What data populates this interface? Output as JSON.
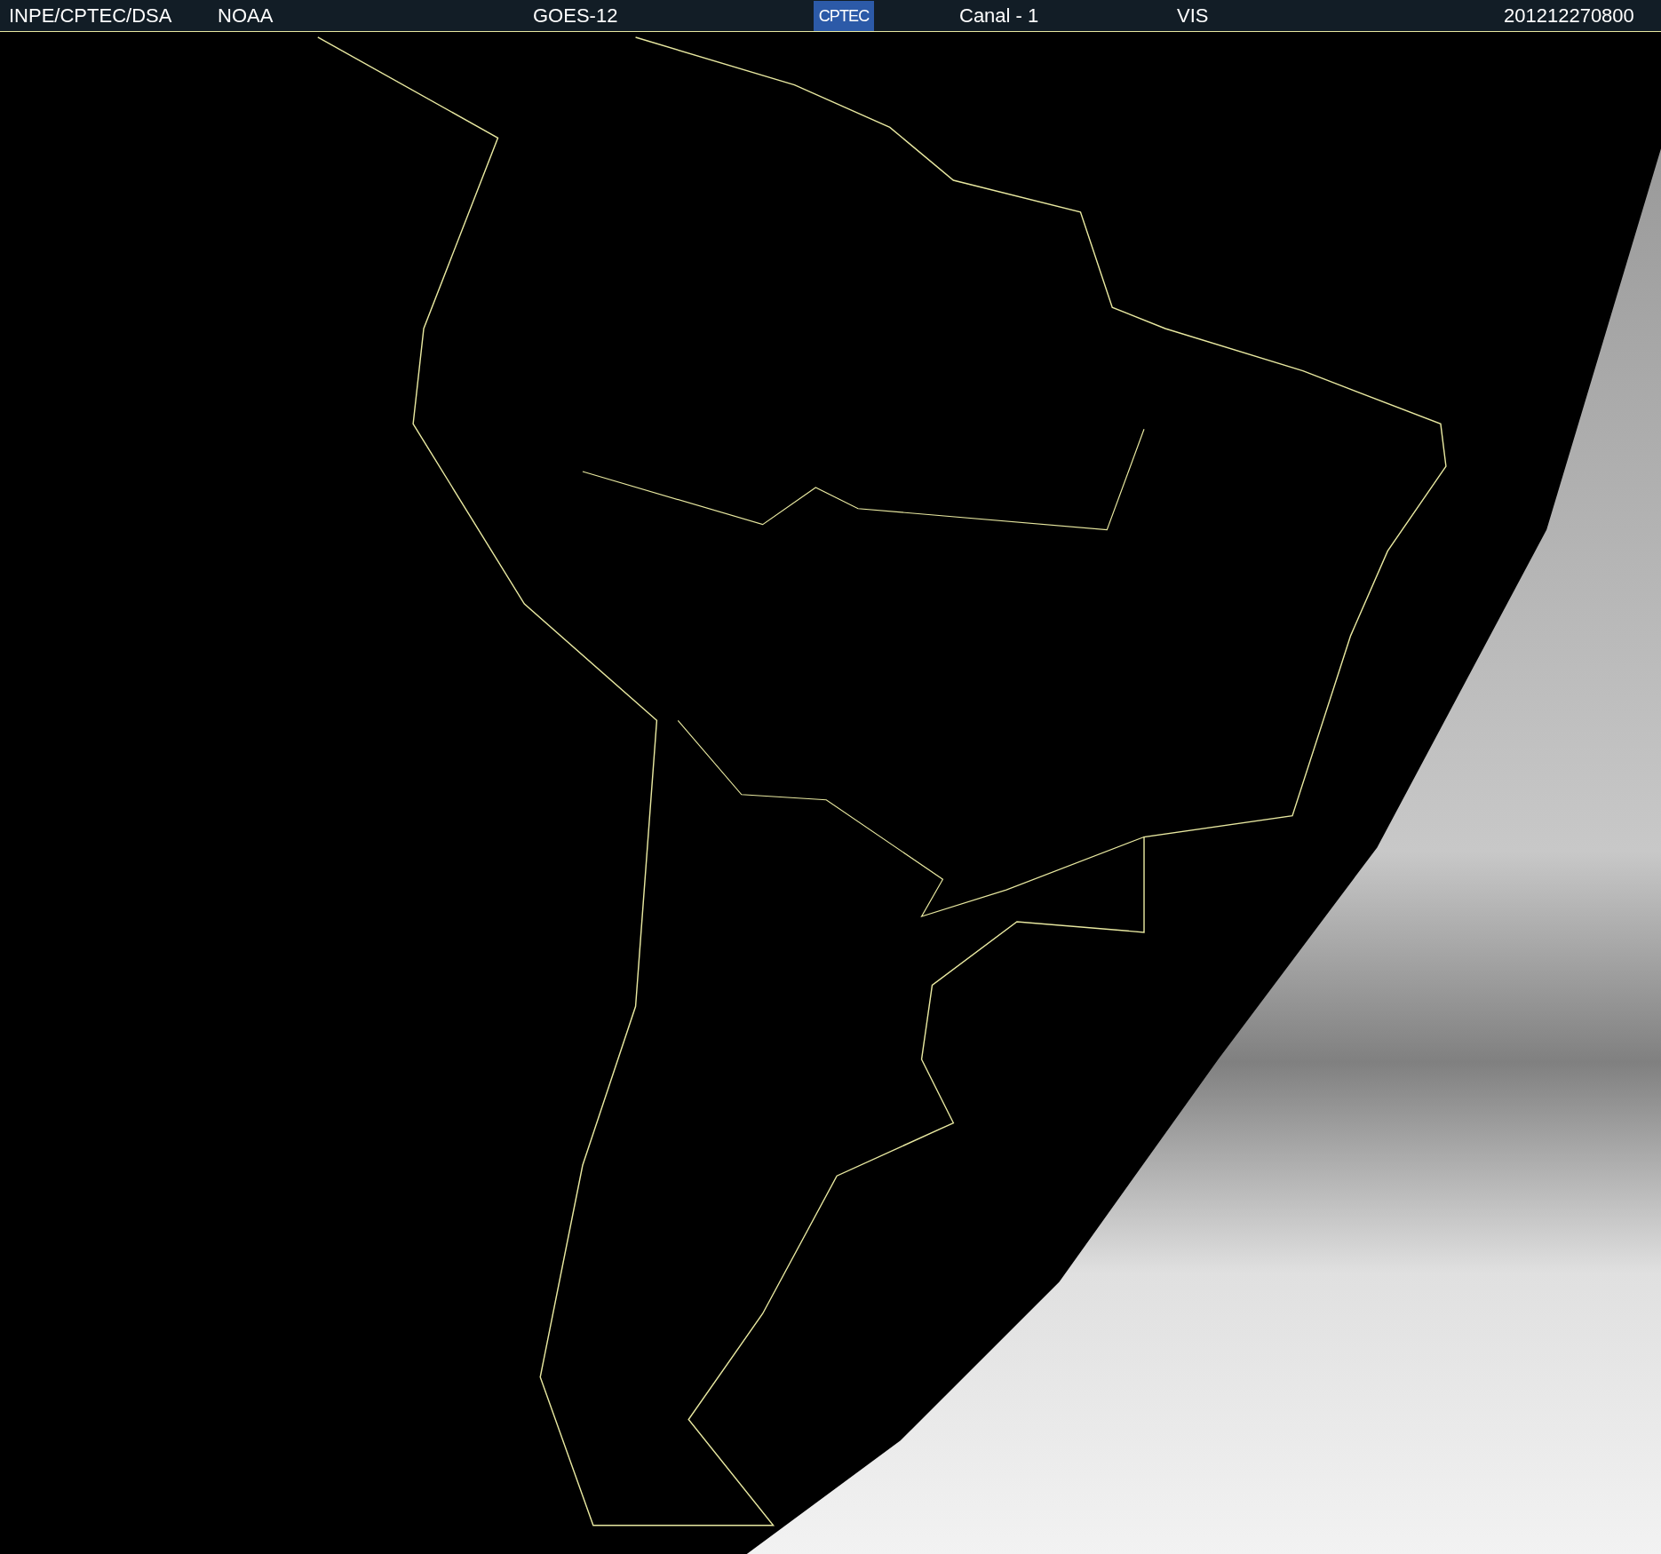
{
  "header": {
    "items": [
      {
        "kind": "text",
        "text": "INPE/CPTEC/DSA"
      },
      {
        "kind": "text",
        "text": "NOAA"
      },
      {
        "kind": "text",
        "text": "GOES-12"
      },
      {
        "kind": "logo",
        "text": "CPTEC"
      },
      {
        "kind": "text",
        "text": "Canal - 1"
      },
      {
        "kind": "text",
        "text": "VIS"
      },
      {
        "kind": "text",
        "text": "201212270800"
      }
    ]
  }
}
